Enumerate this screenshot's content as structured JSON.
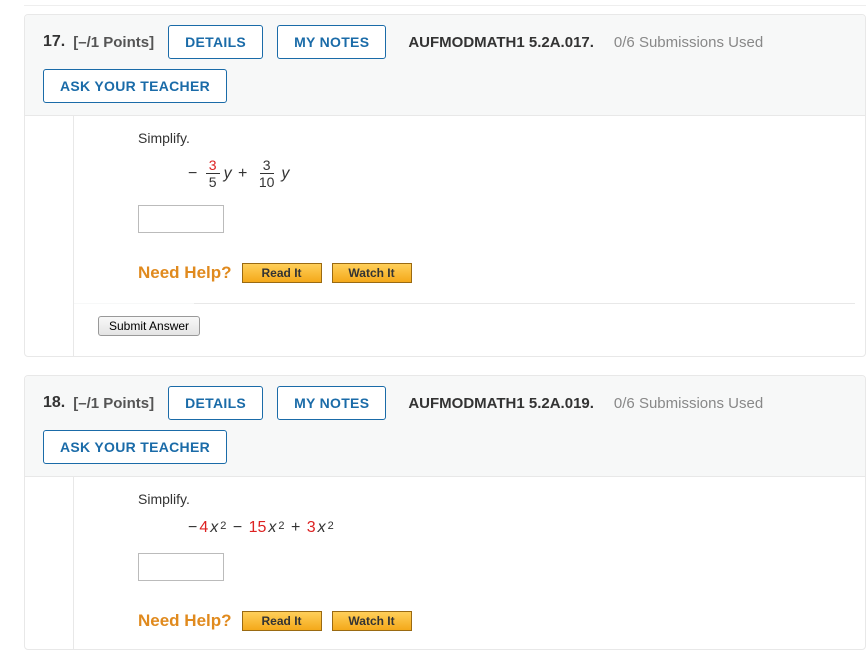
{
  "buttons": {
    "details": "DETAILS",
    "my_notes": "MY NOTES",
    "ask_teacher": "ASK YOUR TEACHER",
    "read_it": "Read It",
    "watch_it": "Watch It",
    "submit": "Submit Answer"
  },
  "labels": {
    "need_help": "Need Help?",
    "simplify": "Simplify."
  },
  "questions": [
    {
      "number": "17.",
      "points": "[–/1 Points]",
      "code": "AUFMODMATH1 5.2A.017.",
      "submissions": "0/6 Submissions Used",
      "expr": {
        "type": "fraction",
        "term1_num": "3",
        "term1_den": "5",
        "term2_num": "3",
        "term2_den": "10",
        "var": "y"
      }
    },
    {
      "number": "18.",
      "points": "[–/1 Points]",
      "code": "AUFMODMATH1 5.2A.019.",
      "submissions": "0/6 Submissions Used",
      "expr": {
        "type": "poly",
        "c1": "4",
        "c2": "15",
        "c3": "3",
        "var": "x",
        "pow": "2"
      }
    }
  ]
}
